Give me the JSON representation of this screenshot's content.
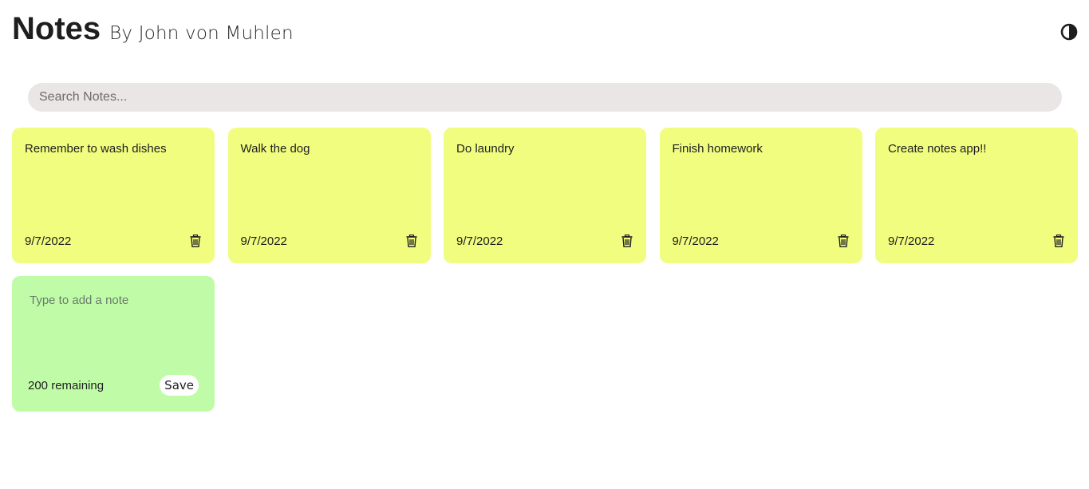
{
  "header": {
    "title": "Notes",
    "subtitle": "By John von Muhlen",
    "theme_toggle_icon": "contrast-icon"
  },
  "search": {
    "placeholder": "Search Notes...",
    "value": ""
  },
  "notes": [
    {
      "text": "Remember to wash dishes",
      "date": "9/7/2022",
      "delete_icon": "trash-icon"
    },
    {
      "text": "Walk the dog",
      "date": "9/7/2022",
      "delete_icon": "trash-icon"
    },
    {
      "text": "Do laundry",
      "date": "9/7/2022",
      "delete_icon": "trash-icon"
    },
    {
      "text": "Finish homework",
      "date": "9/7/2022",
      "delete_icon": "trash-icon"
    },
    {
      "text": "Create notes app!!",
      "date": "9/7/2022",
      "delete_icon": "trash-icon"
    }
  ],
  "new_note": {
    "placeholder": "Type to add a note",
    "value": "",
    "remaining_text": "200 remaining",
    "save_label": "Save"
  },
  "colors": {
    "note_background": "#f0fd7f",
    "new_note_background": "#c0fca8",
    "search_background": "#ebe6e6"
  }
}
